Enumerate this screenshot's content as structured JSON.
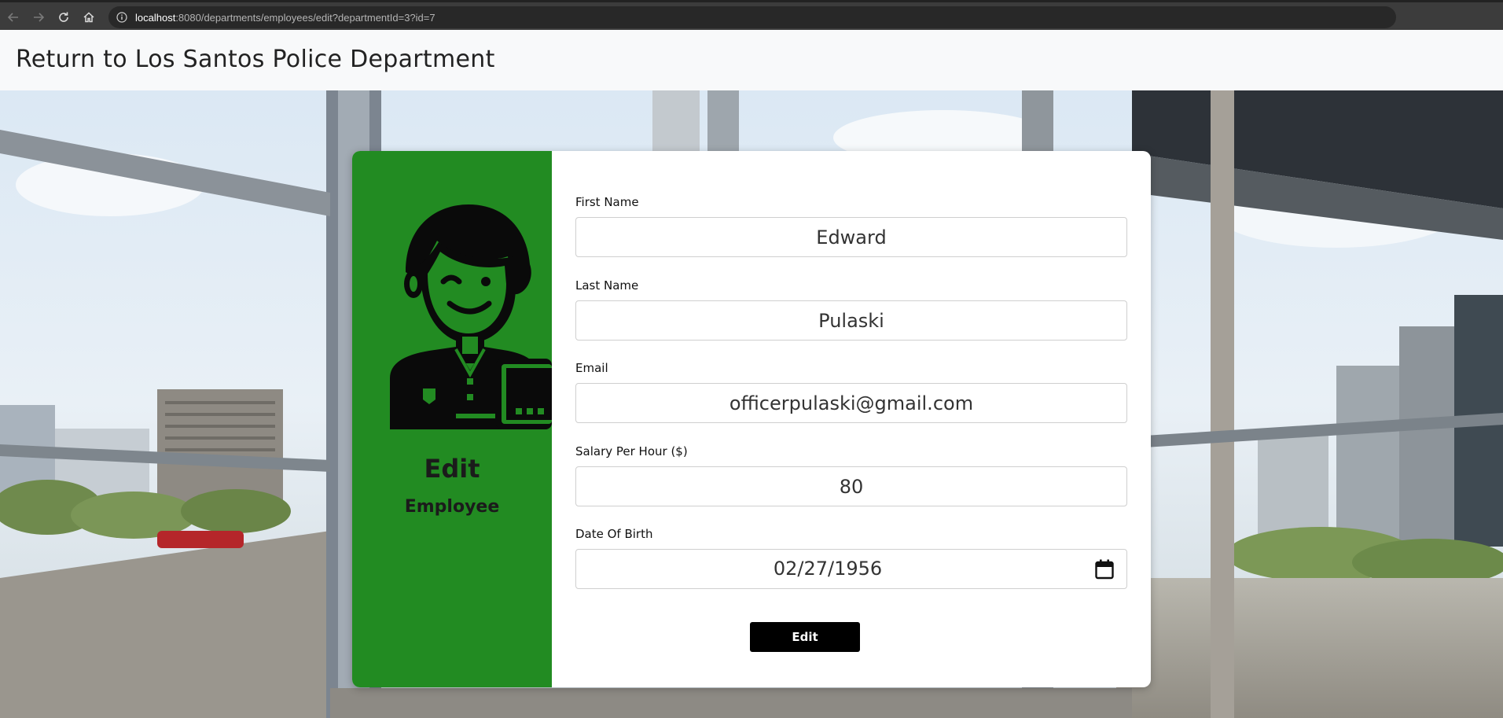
{
  "browser": {
    "url_host": "localhost",
    "url_path": ":8080/departments/employees/edit?departmentId=3?id=7"
  },
  "header": {
    "return_link": "Return to Los Santos Police Department"
  },
  "sidebar_card": {
    "title": "Edit",
    "subtitle": "Employee",
    "avatar_icon": "employee-avatar-icon",
    "background_color": "#228b22"
  },
  "form": {
    "first_name": {
      "label": "First Name",
      "value": "Edward"
    },
    "last_name": {
      "label": "Last Name",
      "value": "Pulaski"
    },
    "email": {
      "label": "Email",
      "value": "officerpulaski@gmail.com"
    },
    "salary": {
      "label": "Salary Per Hour ($)",
      "value": "80"
    },
    "dob": {
      "label": "Date Of Birth",
      "value": "02/27/1956",
      "icon": "calendar-icon"
    },
    "submit_label": "Edit"
  }
}
